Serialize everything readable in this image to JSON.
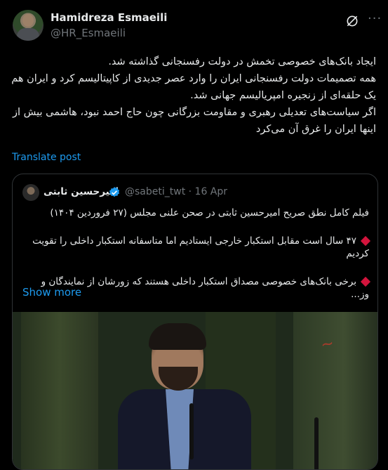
{
  "author": {
    "name": "Hamidreza Esmaeili",
    "handle": "@HR_Esmaeili"
  },
  "icons": {
    "grok": "grok-icon",
    "more": "more-icon",
    "verified": "verified-badge-icon"
  },
  "post": {
    "lines": [
      "ایجاد بانک‌های خصوصی تخمش در دولت رفسنجانی گذاشته شد.",
      "همه تصمیمات دولت رفسنجانی ایران را وارد عصر جدیدی از کاپیتالیسم کرد و ایران هم یک حلقه‌ای از زنجیره امپریالیسم جهانی شد.",
      "اگر سیاست‌های تعدیلی رهبری و مقاومت بزرگانی چون حاج احمد نبود، هاشمی بیش از اینها ایران را غرق آن می‌کرد"
    ],
    "translate_label": "Translate post"
  },
  "quote": {
    "name": "امیرحسین ثابتی",
    "handle": "@sabeti_twt",
    "separator": "·",
    "date": "16 Apr",
    "lines": [
      "فیلم کامل نطق صریح امیرحسین ثابتی در صحن علنی مجلس (۲۷ فروردین ۱۴۰۴)",
      "۴۷ سال است مقابل استکبار خارجی ایستادیم اما متاسفانه استکبار داخلی را تقویت کردیم",
      "برخی بانک‌های خصوصی مصداق استکبار داخلی هستند که زورشان از نمایندگان و وز..."
    ],
    "show_more": "Show more",
    "accent": "#d3143c"
  },
  "colors": {
    "link": "#1d9bf0",
    "muted": "#71767b",
    "text": "#e7e9ea",
    "border": "#2f3336"
  }
}
